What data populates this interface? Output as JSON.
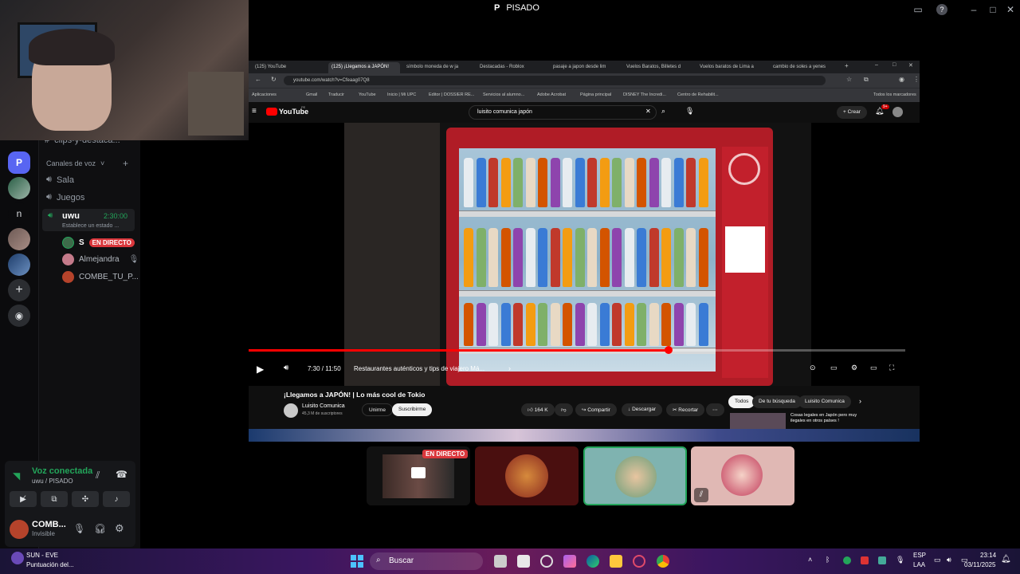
{
  "window": {
    "title_prefix": "P",
    "title": "PISADO"
  },
  "servers": [
    {
      "label": "P",
      "active": true
    },
    {
      "label": "n",
      "active": false
    }
  ],
  "sidebar": {
    "text_channel": "clips-y-destaca...",
    "voice_section": "Canales de voz",
    "voice_channels": [
      "Sala",
      "Juegos"
    ],
    "active_voice": {
      "name": "uwu",
      "timer": "2:30:00",
      "status_placeholder": "Establece un estado ..."
    },
    "members": [
      {
        "name": "S",
        "live": true,
        "live_label": "EN DIRECTO"
      },
      {
        "name": "Almejandra"
      },
      {
        "name": "COMBE_TU_P..."
      }
    ]
  },
  "voice_panel": {
    "status": "Voz conectada",
    "channel": "uwu / PISADO",
    "user_name": "COMB...",
    "user_status": "Invisible"
  },
  "browser": {
    "tabs": [
      "(125) YouTube",
      "(125) ¡Llegamos a JAPÓN!",
      "símbolo moneda de w ja",
      "Destacadas - Roblox",
      "pasaje a japon desde lim",
      "Vuelos Baratos, Billetes d",
      "Vuelos baratos de Lima a",
      "cambio de soles a yenes"
    ],
    "url": "youtube.com/watch?v=Cfeaag07Q8",
    "bookmarks": [
      "Aplicaciones",
      "Gmail",
      "Traducir",
      "YouTube",
      "Inicio | Mi UPC",
      "Editor | DOSSIER RE...",
      "Servicios al alumno...",
      "Adobe Acrobat",
      "Página principal",
      "DISNEY The Incredi...",
      "Centro de Rehabilit..."
    ],
    "all_bookmarks": "Todos los marcadores"
  },
  "youtube": {
    "logo": "YouTube",
    "logo_sup": "PE",
    "search_query": "luisito comunica japón",
    "create_label": "Crear",
    "notif_count": "9+",
    "video": {
      "progress_fraction": 0.64,
      "time": "7:30 / 11:50",
      "chapter": "Restaurantes auténticos y tips de viajero Má...",
      "title": "¡Llegamos a JAPÓN! | Lo más cool de Tokio",
      "channel": "Luisito Comunica",
      "subscribers": "45,3 M de suscriptores",
      "join": "Unirme",
      "subscribe": "Suscribirme",
      "likes": "164 K",
      "share": "Compartir",
      "download": "Descargar",
      "clip": "Recortar"
    },
    "filter_chips": [
      "Todos",
      "De tu búsqueda",
      "Luisito Comunica"
    ],
    "related_title": "Cosas legales en Japón pero muy ilegales en otros países !"
  },
  "tiles": {
    "live_label": "EN DIRECTO"
  },
  "taskbar": {
    "weather_title": "SUN - EVE",
    "weather_sub": "Puntuación del...",
    "search_placeholder": "Buscar",
    "lang": "ESP",
    "lang_sub": "LAA",
    "time": "23:14",
    "date": "03/11/2025"
  },
  "colors": {
    "discord_green": "#23a55a",
    "discord_live_red": "#da373c",
    "youtube_red": "#ff0000",
    "blurple": "#5865f2"
  }
}
